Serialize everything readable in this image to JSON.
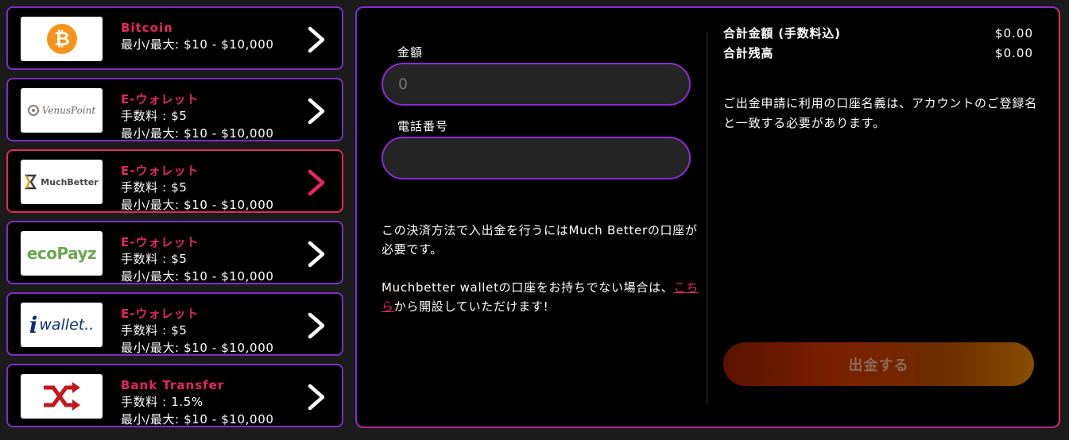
{
  "methods": [
    {
      "logo": "bitcoin-logo",
      "title": "Bitcoin",
      "lines": [
        "最小/最大: $10 - $10,000"
      ],
      "selected": false
    },
    {
      "logo": "venus-point-logo",
      "logo_text": "VenusPoint",
      "title": "E-ウォレット",
      "lines": [
        "手数料 : $5",
        "最小/最大: $10 - $10,000"
      ],
      "selected": false
    },
    {
      "logo": "muchbetter-logo",
      "logo_text": "MuchBetter",
      "title": "E-ウォレット",
      "lines": [
        "手数料 : $5",
        "最小/最大: $10 - $10,000"
      ],
      "selected": true
    },
    {
      "logo": "ecopayz-logo",
      "logo_text": "ecoPayz",
      "title": "E-ウォレット",
      "lines": [
        "手数料 : $5",
        "最小/最大: $10 - $10,000"
      ],
      "selected": false
    },
    {
      "logo": "iwallet-logo",
      "logo_text": "wallet..",
      "title": "E-ウォレット",
      "lines": [
        "手数料 : $5",
        "最小/最大: $10 - $10,000"
      ],
      "selected": false
    },
    {
      "logo": "bank-transfer-logo",
      "title": "Bank Transfer",
      "lines": [
        "手数料 : 1.5%",
        "最小/最大: $10 - $10,000"
      ],
      "selected": false
    }
  ],
  "form": {
    "amount_label": "金額",
    "amount_placeholder": "0",
    "phone_label": "電話番号",
    "phone_placeholder": ""
  },
  "info": {
    "line1": "この決済方法で入出金を行うにはMuch Betterの口座が必要です。",
    "line2_prefix": "Muchbetter walletの口座をお持ちでない場合は、",
    "link": "こちら",
    "line2_suffix": "から開設していただけます!"
  },
  "summary": {
    "total_label": "合計金額 (手数料込)",
    "total_value": "$0.00",
    "balance_label": "合計残高",
    "balance_value": "$0.00"
  },
  "notice": "ご出金申請に利用の口座名義は、アカウントのご登録名と一致する必要があります。",
  "withdraw_button": "出金する",
  "colors": {
    "accent": "#e8265e",
    "border": "#8a2bd1",
    "bitcoin": "#f7931a"
  }
}
